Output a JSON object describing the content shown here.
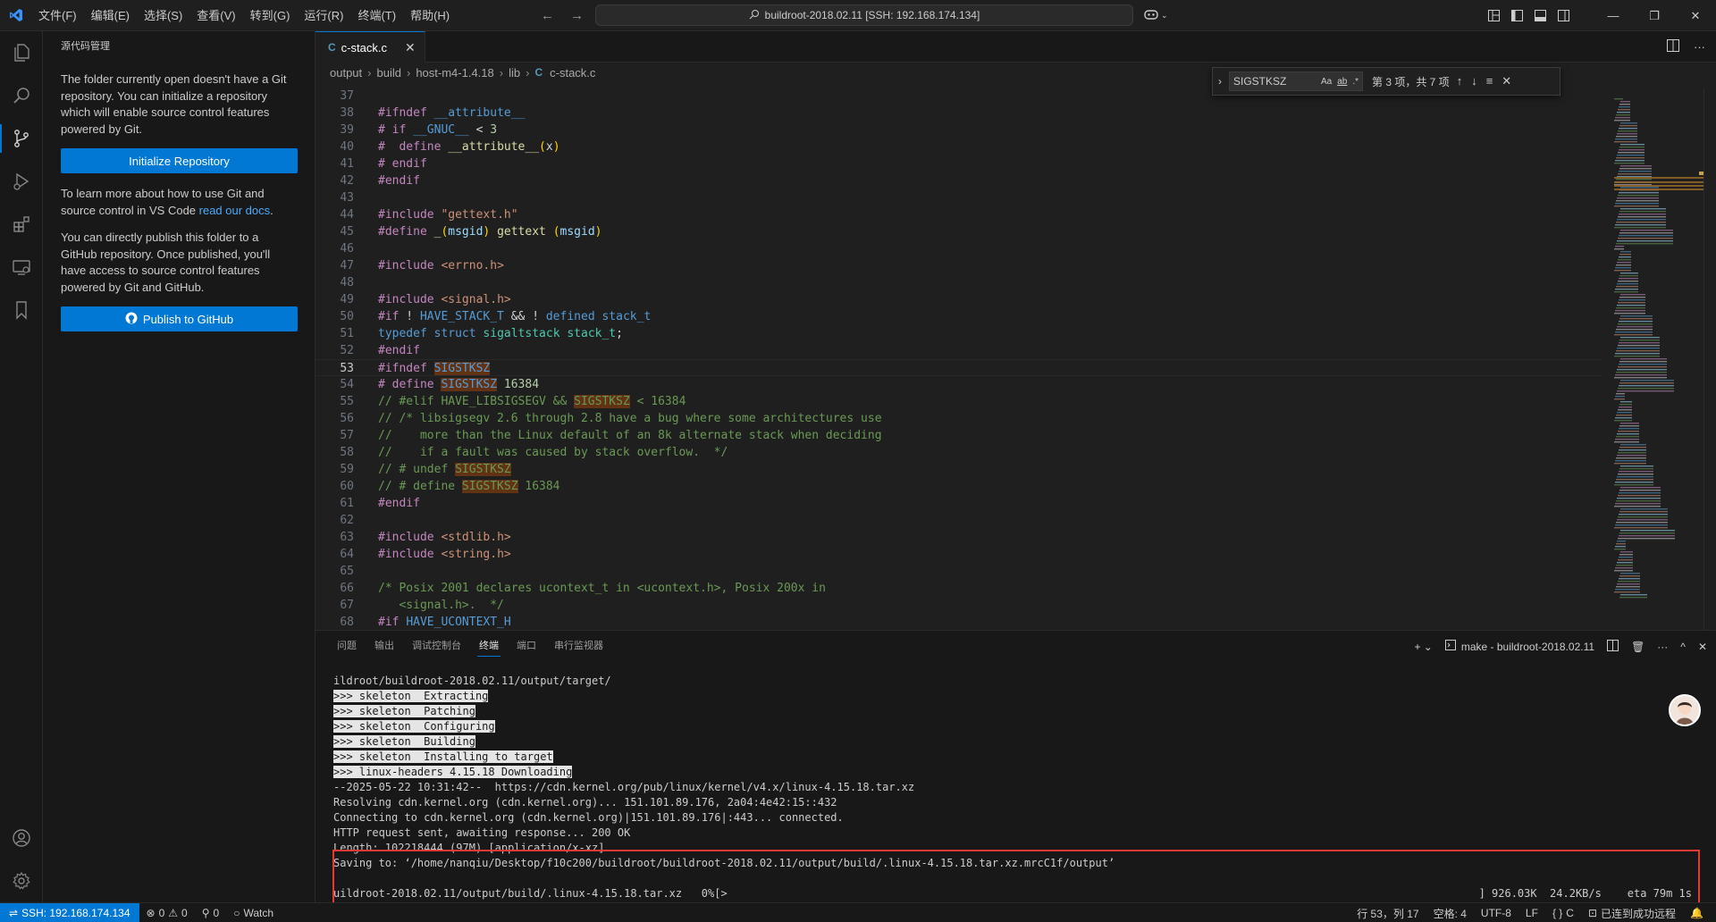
{
  "titlebar": {
    "logo": "vscode-logo",
    "menu": [
      "文件(F)",
      "编辑(E)",
      "选择(S)",
      "查看(V)",
      "转到(G)",
      "运行(R)",
      "终端(T)",
      "帮助(H)"
    ],
    "command_center": "buildroot-2018.02.11 [SSH: 192.168.174.134]"
  },
  "sidebar": {
    "title": "源代码管理",
    "intro": "The folder currently open doesn't have a Git repository. You can initialize a repository which will enable source control features powered by Git.",
    "init_button": "Initialize Repository",
    "learn_text": "To learn more about how to use Git and source control in VS Code ",
    "learn_link": "read our docs",
    "learn_end": ".",
    "publish_text": "You can directly publish this folder to a GitHub repository. Once published, you'll have access to source control features powered by Git and GitHub.",
    "publish_button": "Publish to GitHub"
  },
  "editor": {
    "tab": {
      "icon_label": "C",
      "label": "c-stack.c"
    },
    "breadcrumb": [
      "output",
      "build",
      "host-m4-1.4.18",
      "lib",
      "c-stack.c"
    ],
    "find": {
      "query": "SIGSTKSZ",
      "count": "第 3 项，共 7 项",
      "opt_case": "Aa",
      "opt_word": "ab",
      "opt_regex": ".*"
    },
    "current_line": 53,
    "lines": [
      {
        "n": "37",
        "html": ""
      },
      {
        "n": "38",
        "html": "<span class='kw'>#ifndef</span> <span class='mac'>__attribute__</span>"
      },
      {
        "n": "39",
        "html": "<span class='kw'>#</span> <span class='kw'>if</span> <span class='mac'>__GNUC__</span> &lt; <span class='num'>3</span>"
      },
      {
        "n": "40",
        "html": "<span class='kw'>#</span>  <span class='kw'>define</span> <span class='fn'>__attribute__</span><span class='paren'>(</span>x<span class='paren'>)</span>"
      },
      {
        "n": "41",
        "html": "<span class='kw'>#</span> <span class='kw'>endif</span>"
      },
      {
        "n": "42",
        "html": "<span class='kw'>#endif</span>"
      },
      {
        "n": "43",
        "html": ""
      },
      {
        "n": "44",
        "html": "<span class='kw'>#include</span> <span class='str'>\"gettext.h\"</span>"
      },
      {
        "n": "45",
        "html": "<span class='kw'>#define</span> <span class='fn'>_</span><span class='paren'>(</span><span class='var'>msgid</span><span class='paren'>)</span> <span class='fn'>gettext</span> <span class='paren'>(</span><span class='var'>msgid</span><span class='paren'>)</span>"
      },
      {
        "n": "46",
        "html": ""
      },
      {
        "n": "47",
        "html": "<span class='kw'>#include</span> <span class='str'>&lt;errno.h&gt;</span>"
      },
      {
        "n": "48",
        "html": ""
      },
      {
        "n": "49",
        "html": "<span class='kw'>#include</span> <span class='str'>&lt;signal.h&gt;</span>"
      },
      {
        "n": "50",
        "html": "<span class='kw'>#if</span> ! <span class='mac'>HAVE_STACK_T</span> &amp;&amp; ! <span class='kw2'>defined</span> <span class='mac'>stack_t</span>"
      },
      {
        "n": "51",
        "html": "<span class='kw2'>typedef</span> <span class='kw2'>struct</span> <span class='typ'>sigaltstack</span> <span class='typ'>stack_t</span>;"
      },
      {
        "n": "52",
        "html": "<span class='kw'>#endif</span>"
      },
      {
        "n": "53",
        "html": "<span class='kw'>#ifndef</span> <span class='mac hl'>SIGSTKSZ</span>"
      },
      {
        "n": "54",
        "html": "<span class='kw'>#</span> <span class='kw'>define</span> <span class='mac hl'>SIGSTKSZ</span> <span class='num'>16384</span>"
      },
      {
        "n": "55",
        "html": "<span class='cmt'>// #elif HAVE_LIBSIGSEGV &amp;&amp; <span class='hl'>SIGSTKSZ</span> &lt; 16384</span>"
      },
      {
        "n": "56",
        "html": "<span class='cmt'>// /* libsigsegv 2.6 through 2.8 have a bug where some architectures use</span>"
      },
      {
        "n": "57",
        "html": "<span class='cmt'>//    more than the Linux default of an 8k alternate stack when deciding</span>"
      },
      {
        "n": "58",
        "html": "<span class='cmt'>//    if a fault was caused by stack overflow.  */</span>"
      },
      {
        "n": "59",
        "html": "<span class='cmt'>// # undef <span class='hl'>SIGSTKSZ</span></span>"
      },
      {
        "n": "60",
        "html": "<span class='cmt'>// # define <span class='hl'>SIGSTKSZ</span> 16384</span>"
      },
      {
        "n": "61",
        "html": "<span class='kw'>#endif</span>"
      },
      {
        "n": "62",
        "html": ""
      },
      {
        "n": "63",
        "html": "<span class='kw'>#include</span> <span class='str'>&lt;stdlib.h&gt;</span>"
      },
      {
        "n": "64",
        "html": "<span class='kw'>#include</span> <span class='str'>&lt;string.h&gt;</span>"
      },
      {
        "n": "65",
        "html": ""
      },
      {
        "n": "66",
        "html": "<span class='cmt'>/* Posix 2001 declares ucontext_t in &lt;ucontext.h&gt;, Posix 200x in</span>"
      },
      {
        "n": "67",
        "html": "<span class='cmt'>   &lt;signal.h&gt;.  */</span>"
      },
      {
        "n": "68",
        "html": "<span class='kw'>#if</span> <span class='mac'>HAVE_UCONTEXT_H</span>"
      }
    ]
  },
  "panel": {
    "tabs": [
      "问题",
      "输出",
      "调试控制台",
      "终端",
      "端口",
      "串行监视器"
    ],
    "active_tab": "终端",
    "terminal_name": "make - buildroot-2018.02.11",
    "terminal_lines": [
      {
        "text": "ildroot/buildroot-2018.02.11/output/target/",
        "inv": false
      },
      {
        "text": ">>> skeleton  Extracting",
        "inv": true
      },
      {
        "text": ">>> skeleton  Patching",
        "inv": true
      },
      {
        "text": ">>> skeleton  Configuring",
        "inv": true
      },
      {
        "text": ">>> skeleton  Building",
        "inv": true
      },
      {
        "text": ">>> skeleton  Installing to target",
        "inv": true
      },
      {
        "text": ">>> linux-headers 4.15.18 Downloading",
        "inv": true
      },
      {
        "text": "--2025-05-22 10:31:42--  https://cdn.kernel.org/pub/linux/kernel/v4.x/linux-4.15.18.tar.xz",
        "inv": false
      },
      {
        "text": "Resolving cdn.kernel.org (cdn.kernel.org)... 151.101.89.176, 2a04:4e42:15::432",
        "inv": false
      },
      {
        "text": "Connecting to cdn.kernel.org (cdn.kernel.org)|151.101.89.176|:443... connected.",
        "inv": false
      },
      {
        "text": "HTTP request sent, awaiting response... 200 OK",
        "inv": false
      },
      {
        "text": "Length: 102218444 (97M) [application/x-xz]",
        "inv": false
      },
      {
        "text": "Saving to: ‘/home/nanqiu/Desktop/f10c200/buildroot/buildroot-2018.02.11/output/build/.linux-4.15.18.tar.xz.mrcC1f/output’",
        "inv": false
      },
      {
        "text": "",
        "inv": false
      },
      {
        "text": "uildroot-2018.02.11/output/build/.linux-4.15.18.tar.xz   0%[>",
        "inv": false
      }
    ],
    "progress_right": "] 926.03K  24.2KB/s    eta 79m 1s"
  },
  "statusbar": {
    "remote": "SSH: 192.168.174.134",
    "errors": "0",
    "warnings": "0",
    "ports": "0",
    "watch": "Watch",
    "position": "行 53，列 17",
    "spaces": "空格: 4",
    "encoding": "UTF-8",
    "eol": "LF",
    "language": "C",
    "notify": "已连到成功远程"
  }
}
